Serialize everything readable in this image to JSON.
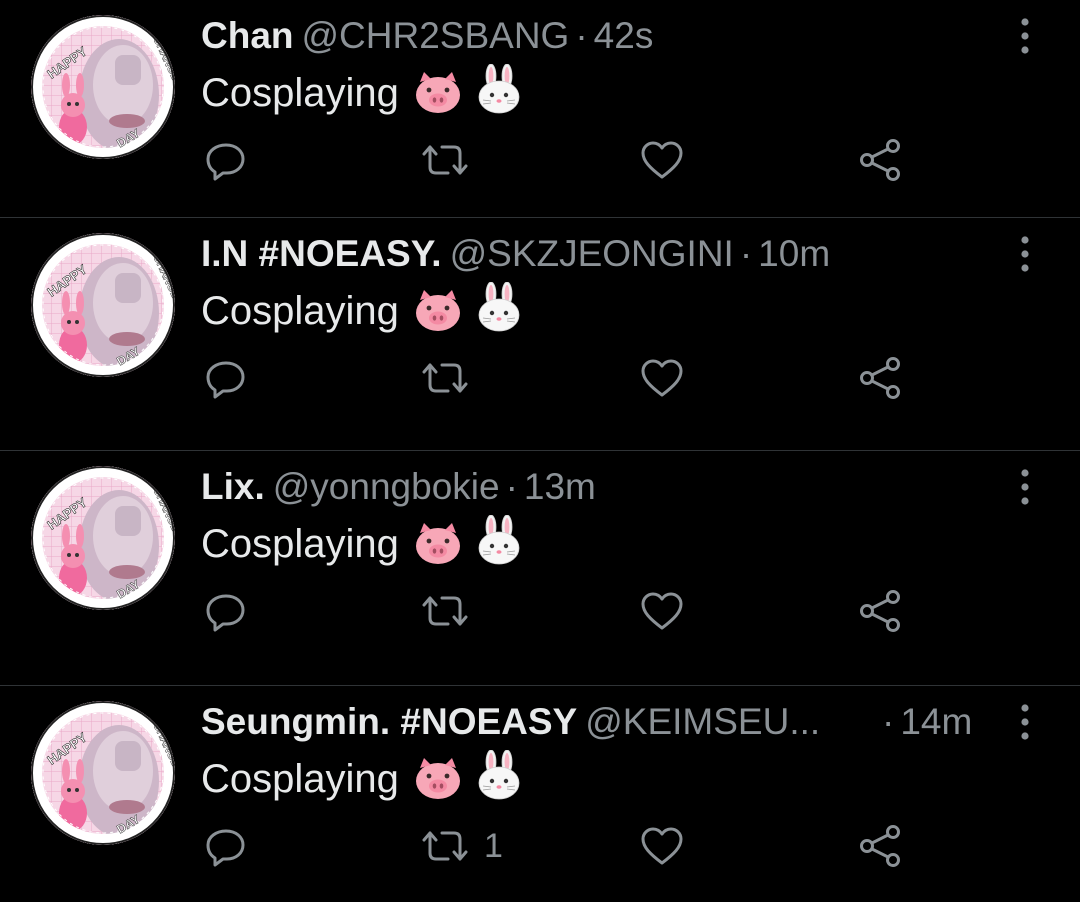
{
  "tweets": [
    {
      "name": "Chan",
      "handle": "@CHR2SBANG",
      "time": "42s",
      "text": "Cosplaying",
      "emojis": [
        "pig-face",
        "rabbit-face"
      ],
      "retweet_count": ""
    },
    {
      "name": "I.N #NOEASY.",
      "handle": "@SKZJEONGINI",
      "time": "10m",
      "text": "Cosplaying",
      "emojis": [
        "pig-face",
        "rabbit-face"
      ],
      "retweet_count": ""
    },
    {
      "name": "Lix.",
      "handle": "@yonngbokie",
      "time": "13m",
      "text": "Cosplaying",
      "emojis": [
        "pig-face",
        "rabbit-face"
      ],
      "retweet_count": ""
    },
    {
      "name": "Seungmin. #NOEASY",
      "handle": "@KEIMSEU...",
      "time": "14m",
      "text": "Cosplaying",
      "emojis": [
        "pig-face",
        "rabbit-face"
      ],
      "retweet_count": "1"
    }
  ],
  "avatar": {
    "text_top": "HAPPY",
    "text_side": "CHANGBIN'S",
    "text_bottom": "DAY"
  },
  "icons": [
    "reply-icon",
    "retweet-icon",
    "like-icon",
    "share-icon",
    "more-icon"
  ],
  "colors": {
    "background": "#000000",
    "primary_text": "#e7e9ea",
    "secondary_text": "#8b9196",
    "divider": "#2f3336",
    "avatar_accent": "#f48fb1"
  }
}
